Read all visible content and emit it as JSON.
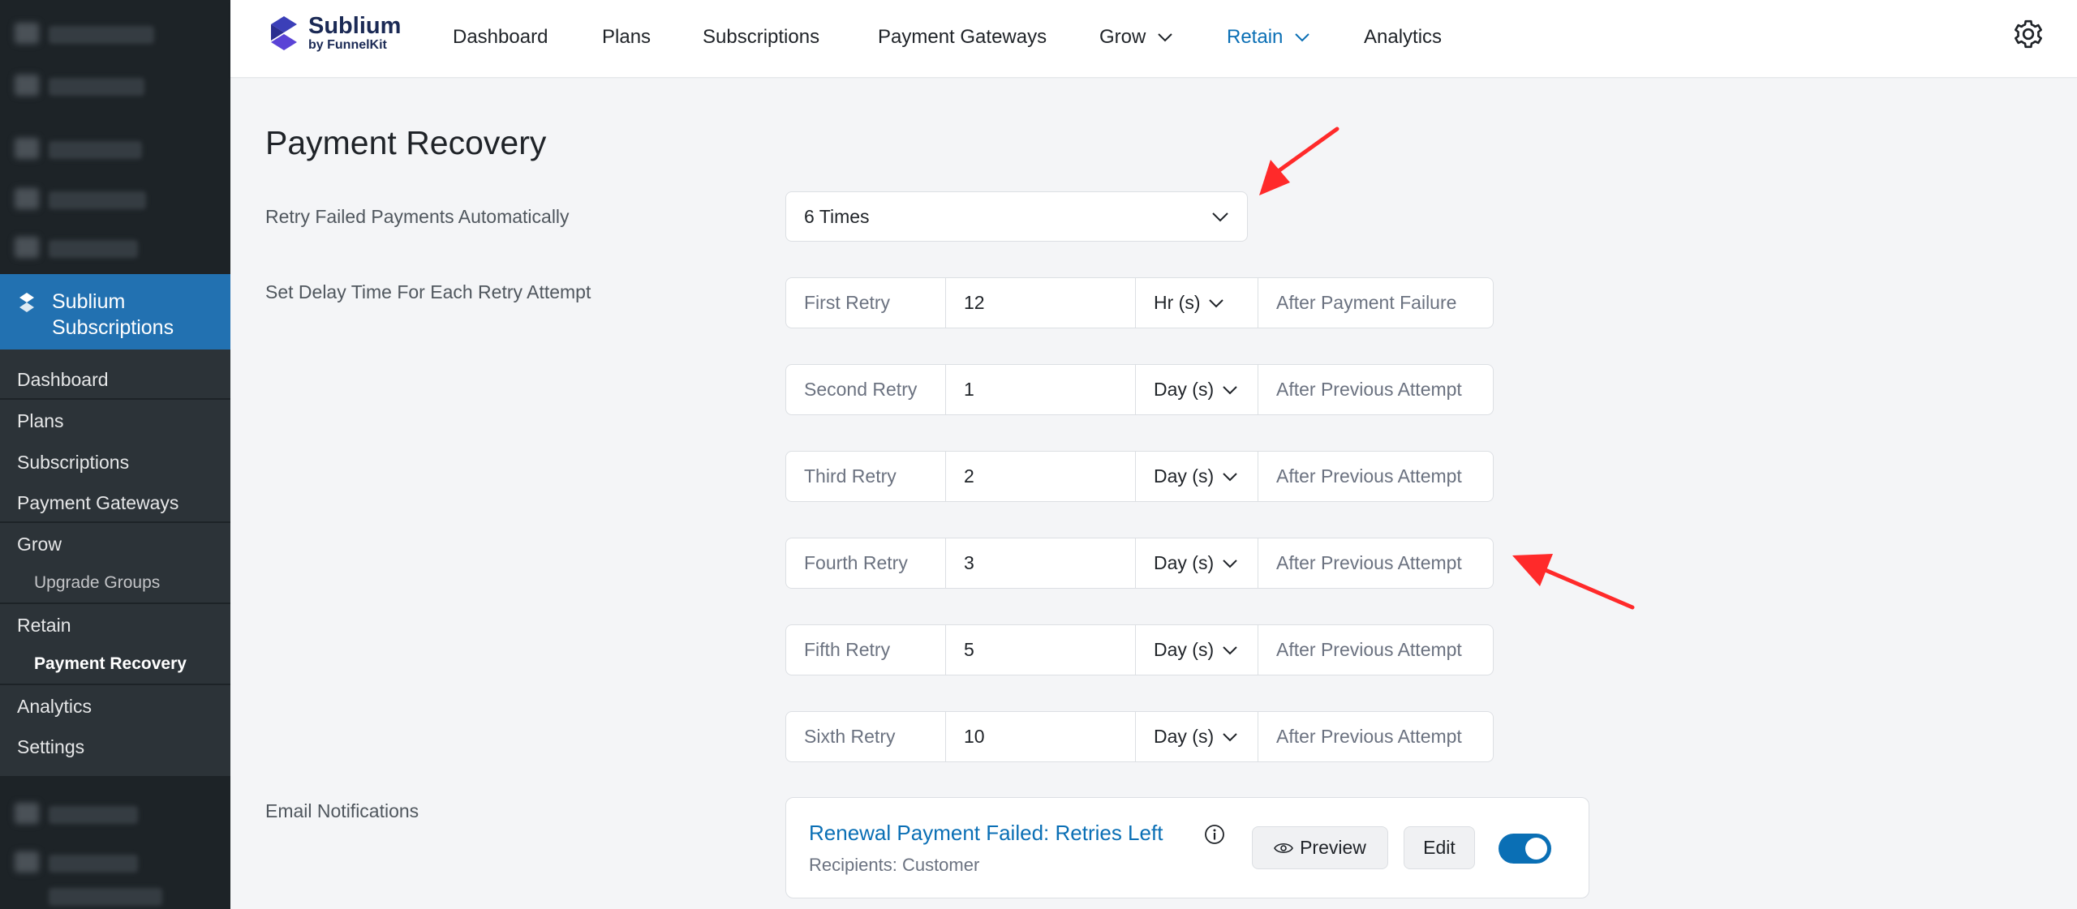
{
  "sidebar": {
    "app_name_line1": "Sublium",
    "app_name_line2": "Subscriptions",
    "menu": [
      "Dashboard",
      "Plans",
      "Subscriptions",
      "Payment Gateways",
      "Grow"
    ],
    "grow_sub": "Upgrade Groups",
    "retain": "Retain",
    "retain_sub": "Payment Recovery",
    "analytics": "Analytics",
    "settings": "Settings"
  },
  "brand": {
    "name": "Sublium",
    "byline": "by FunnelKit"
  },
  "nav": {
    "dashboard": "Dashboard",
    "plans": "Plans",
    "subscriptions": "Subscriptions",
    "payment_gateways": "Payment Gateways",
    "grow": "Grow",
    "retain": "Retain",
    "analytics": "Analytics"
  },
  "page": {
    "title": "Payment Recovery",
    "retry_label": "Retry Failed Payments Automatically",
    "retry_value": "6 Times",
    "delay_label": "Set Delay Time For Each Retry Attempt",
    "email_label": "Email Notifications"
  },
  "retries": [
    {
      "label": "First Retry",
      "value": "12",
      "unit": "Hr (s)",
      "after": "After Payment Failure"
    },
    {
      "label": "Second Retry",
      "value": "1",
      "unit": "Day (s)",
      "after": "After Previous Attempt"
    },
    {
      "label": "Third Retry",
      "value": "2",
      "unit": "Day (s)",
      "after": "After Previous Attempt"
    },
    {
      "label": "Fourth Retry",
      "value": "3",
      "unit": "Day (s)",
      "after": "After Previous Attempt"
    },
    {
      "label": "Fifth Retry",
      "value": "5",
      "unit": "Day (s)",
      "after": "After Previous Attempt"
    },
    {
      "label": "Sixth Retry",
      "value": "10",
      "unit": "Day (s)",
      "after": "After Previous Attempt"
    }
  ],
  "email": {
    "title": "Renewal Payment Failed: Retries Left",
    "recipients": "Recipients: Customer",
    "preview": "Preview",
    "edit": "Edit",
    "enabled": true
  },
  "colors": {
    "accent": "#0a6fb5",
    "sidebar_active": "#2271b1",
    "annotation": "#ff2a2a"
  }
}
